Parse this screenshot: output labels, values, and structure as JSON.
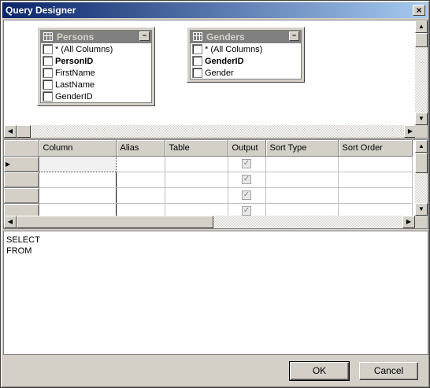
{
  "window": {
    "title": "Query Designer",
    "close_label": "×"
  },
  "diagram": {
    "tables": [
      {
        "name": "Persons",
        "min_label": "−",
        "columns": [
          {
            "label": "* (All Columns)",
            "bold": false
          },
          {
            "label": "PersonID",
            "bold": true
          },
          {
            "label": "FirstName",
            "bold": false
          },
          {
            "label": "LastName",
            "bold": false
          },
          {
            "label": "GenderID",
            "bold": false
          }
        ]
      },
      {
        "name": "Genders",
        "min_label": "−",
        "columns": [
          {
            "label": "* (All Columns)",
            "bold": false
          },
          {
            "label": "GenderID",
            "bold": true
          },
          {
            "label": "Gender",
            "bold": false
          }
        ]
      }
    ]
  },
  "grid": {
    "headers": [
      "Column",
      "Alias",
      "Table",
      "Output",
      "Sort Type",
      "Sort Order"
    ],
    "row_count": 4,
    "current_row_marker": "▶",
    "output_check": "✓"
  },
  "sql": {
    "lines": [
      "SELECT",
      "FROM"
    ]
  },
  "buttons": {
    "ok": "OK",
    "cancel": "Cancel"
  },
  "scroll_glyphs": {
    "up": "▲",
    "down": "▼",
    "left": "◀",
    "right": "▶"
  }
}
